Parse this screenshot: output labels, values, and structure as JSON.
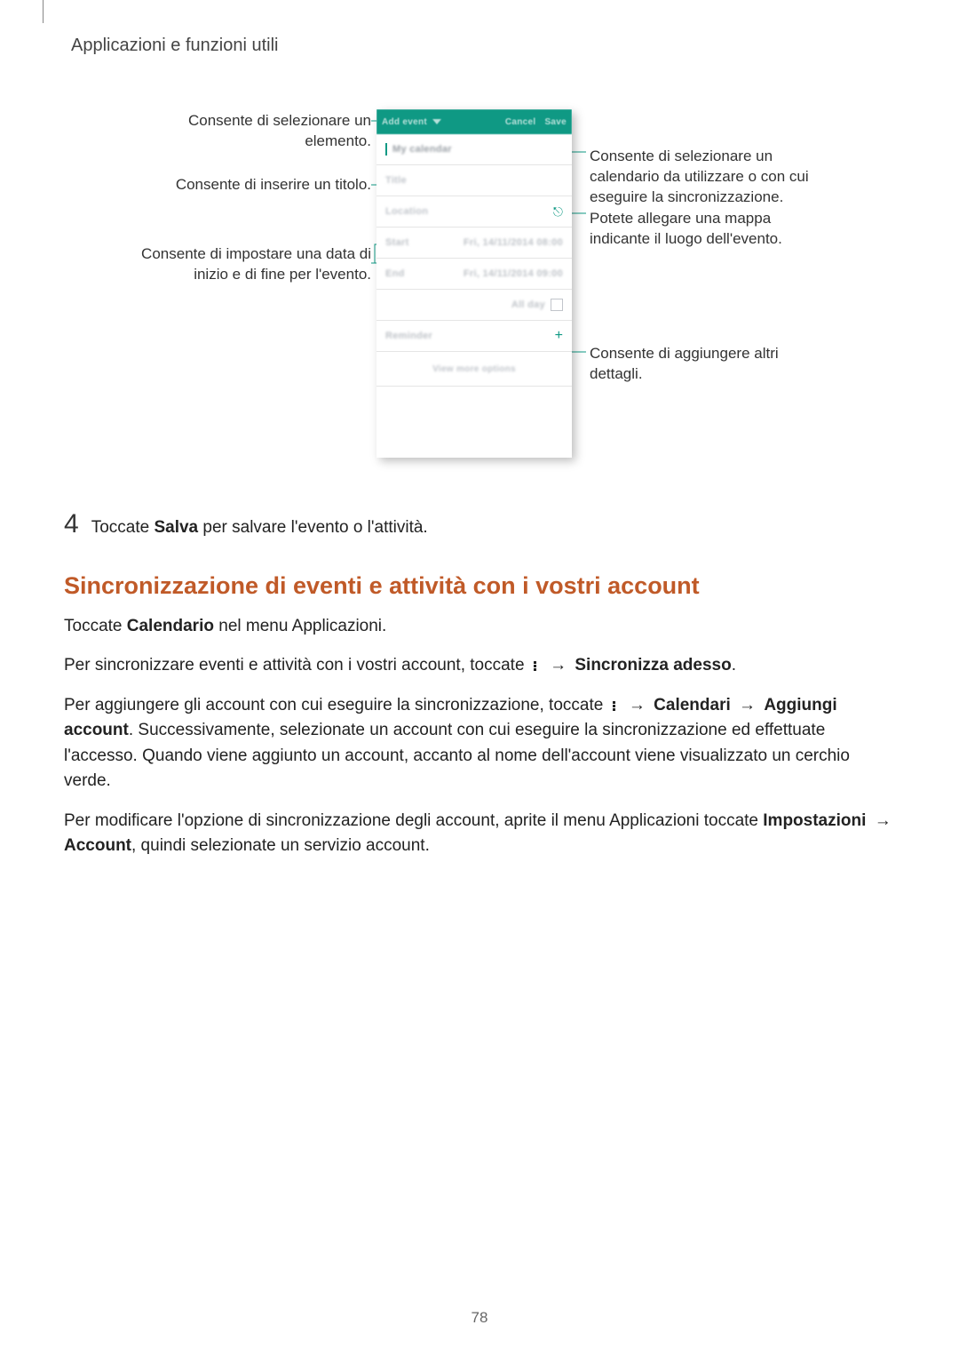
{
  "breadcrumb": "Applicazioni e funzioni utili",
  "callouts": {
    "left1": "Consente di selezionare un elemento.",
    "left2": "Consente di inserire un titolo.",
    "left3": "Consente di impostare una data di inizio e di fine per l'evento.",
    "right1": "Consente di selezionare un calendario da utilizzare o con cui eseguire la sincronizzazione.",
    "right2": "Potete allegare una mappa indicante il luogo dell'evento.",
    "right3": "Consente di aggiungere altri dettagli."
  },
  "phone": {
    "header_title": "Add event",
    "header_cancel": "Cancel",
    "header_save": "Save",
    "mycal": "My calendar",
    "title_ph": "Title",
    "location_ph": "Location",
    "start_lab": "Start",
    "start_val": "Fri, 14/11/2014   08:00",
    "end_lab": "End",
    "end_val": "Fri, 14/11/2014   09:00",
    "allday": "All day",
    "reminder": "Reminder",
    "viewmore": "View more options"
  },
  "step4": {
    "num": "4",
    "pre": "Toccate ",
    "bold": "Salva",
    "post": " per salvare l'evento o l'attività."
  },
  "section_heading": "Sincronizzazione di eventi e attività con i vostri account",
  "p1": {
    "pre": "Toccate ",
    "b": "Calendario",
    "post": " nel menu Applicazioni."
  },
  "p2": {
    "pre": "Per sincronizzare eventi e attività con i vostri account, toccate ",
    "arrow": "→",
    "b": "Sincronizza adesso",
    "post": "."
  },
  "p3": {
    "pre": "Per aggiungere gli account con cui eseguire la sincronizzazione, toccate ",
    "arrow": "→",
    "b1": "Calendari",
    "b2": "Aggiungi account",
    "post": ". Successivamente, selezionate un account con cui eseguire la sincronizzazione ed effettuate l'accesso. Quando viene aggiunto un account, accanto al nome dell'account viene visualizzato un cerchio verde."
  },
  "p4": {
    "pre": "Per modificare l'opzione di sincronizzazione degli account, aprite il menu Applicazioni toccate ",
    "b1": "Impostazioni",
    "arrow": "→",
    "b2": "Account",
    "post": ", quindi selezionate un servizio account."
  },
  "page_number": "78"
}
